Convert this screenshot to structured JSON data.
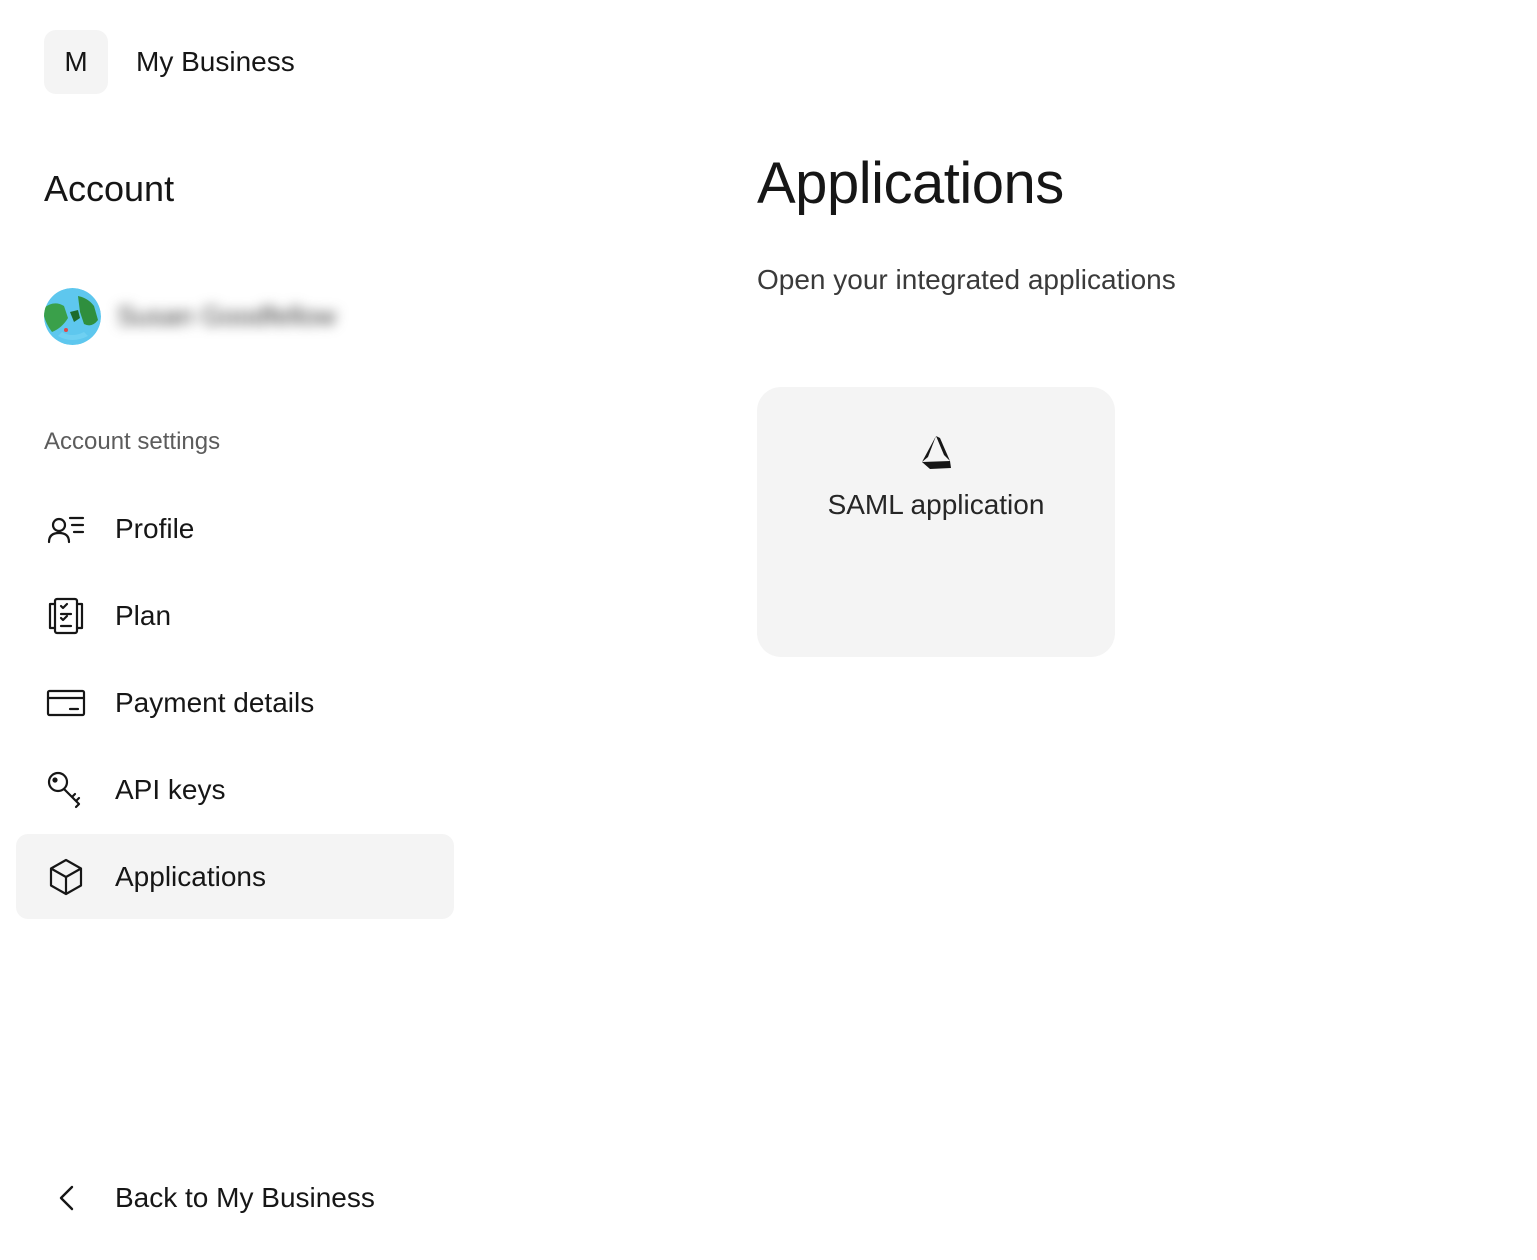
{
  "workspace": {
    "initial": "M",
    "name": "My Business"
  },
  "sidebar": {
    "title": "Account",
    "user": {
      "name": "Susan Goodfellow"
    },
    "section_label": "Account settings",
    "items": [
      {
        "label": "Profile",
        "icon": "user-list-icon",
        "active": false
      },
      {
        "label": "Plan",
        "icon": "checklist-icon",
        "active": false
      },
      {
        "label": "Payment details",
        "icon": "credit-card-icon",
        "active": false
      },
      {
        "label": "API keys",
        "icon": "key-icon",
        "active": false
      },
      {
        "label": "Applications",
        "icon": "cube-icon",
        "active": true
      }
    ],
    "back_label": "Back to My Business"
  },
  "main": {
    "title": "Applications",
    "subtitle": "Open your integrated applications",
    "apps": [
      {
        "label": "SAML application",
        "icon": "saml-logo-icon"
      }
    ]
  },
  "colors": {
    "surface": "#f4f4f4",
    "text_primary": "#161616",
    "text_secondary": "#5c5c5c"
  }
}
